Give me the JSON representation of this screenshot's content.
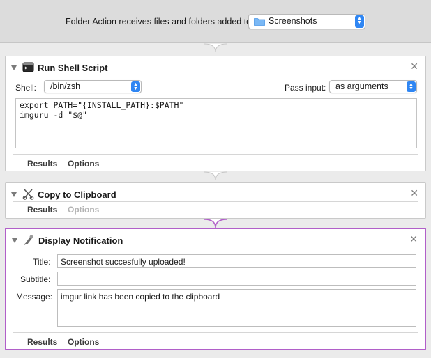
{
  "header": {
    "label": "Folder Action receives files and folders added to",
    "folder_popup_value": "Screenshots"
  },
  "actions": [
    {
      "title": "Run Shell Script",
      "shell_label": "Shell:",
      "shell_value": "/bin/zsh",
      "pass_input_label": "Pass input:",
      "pass_input_value": "as arguments",
      "script_lines": [
        "export PATH=\"{INSTALL_PATH}:$PATH\"",
        "imguru -d \"$@\""
      ],
      "tabs": [
        "Results",
        "Options"
      ]
    },
    {
      "title": "Copy to Clipboard",
      "tabs": [
        "Results",
        "Options"
      ]
    },
    {
      "title": "Display Notification",
      "title_label": "Title:",
      "title_value": "Screenshot succesfully uploaded!",
      "subtitle_label": "Subtitle:",
      "subtitle_value": "",
      "message_label": "Message:",
      "message_value": "imgur link has been copied to the clipboard",
      "tabs": [
        "Results",
        "Options"
      ]
    }
  ],
  "colors": {
    "accent": "#2f86f3",
    "selected_border": "#b15fc9"
  },
  "icons": [
    "folder-icon",
    "terminal-icon",
    "scissors-icon",
    "notification-icon",
    "close-icon",
    "disclosure-triangle-icon",
    "popup-stepper-icon"
  ]
}
